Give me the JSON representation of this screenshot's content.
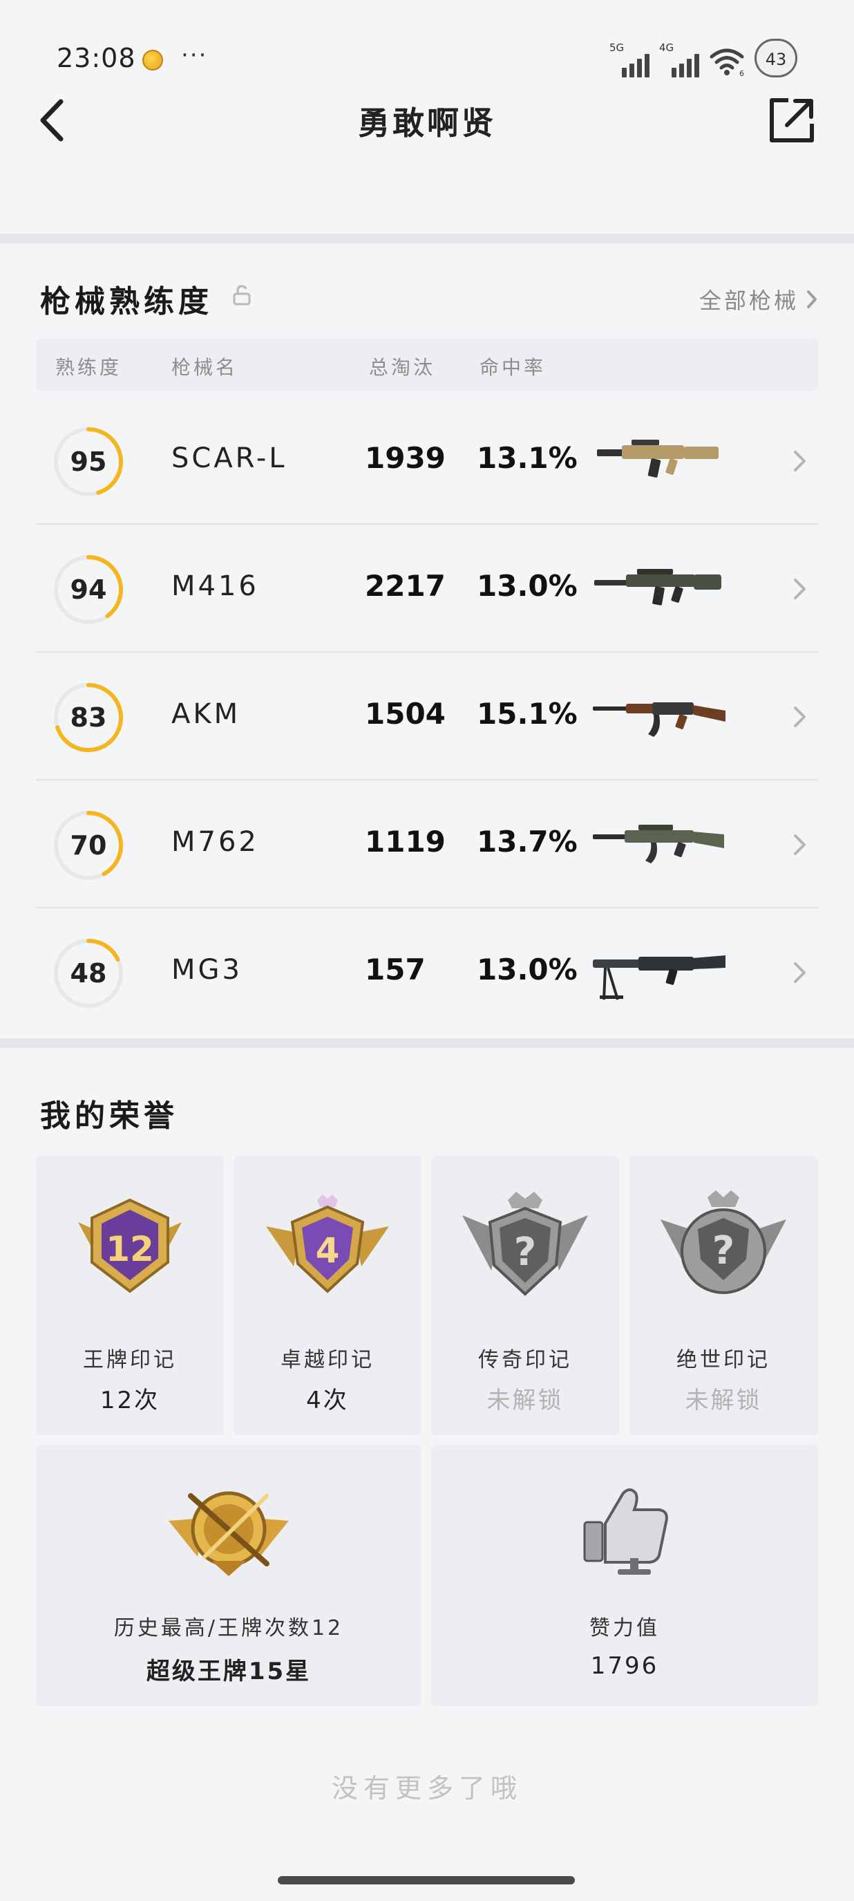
{
  "status_bar": {
    "time": "23:08",
    "more": "···",
    "signal_1_tag": "5G",
    "signal_2_tag": "4G",
    "wifi_tag": "6",
    "battery": "43"
  },
  "nav": {
    "title": "勇敢啊贤",
    "back_icon": "chevron-left-icon",
    "share_icon": "share-external-icon"
  },
  "mastery": {
    "title": "枪械熟练度",
    "lock_icon": "unlock-icon",
    "all_weapons_link": "全部枪械",
    "columns": {
      "proficiency": "熟练度",
      "weapon_name": "枪械名",
      "total_kills": "总淘汰",
      "hit_rate": "命中率"
    },
    "ring_color": "#f5b51e",
    "weapons": [
      {
        "level": "95",
        "level_fraction": 0.45,
        "name": "SCAR-L",
        "kills": "1939",
        "hit_rate": "13.1%",
        "body_color": "#b79a6a"
      },
      {
        "level": "94",
        "level_fraction": 0.4,
        "name": "M416",
        "kills": "2217",
        "hit_rate": "13.0%",
        "body_color": "#4a5044"
      },
      {
        "level": "83",
        "level_fraction": 0.7,
        "name": "AKM",
        "kills": "1504",
        "hit_rate": "15.1%",
        "body_color": "#6e3e22"
      },
      {
        "level": "70",
        "level_fraction": 0.42,
        "name": "M762",
        "kills": "1119",
        "hit_rate": "13.7%",
        "body_color": "#5a6350"
      },
      {
        "level": "48",
        "level_fraction": 0.18,
        "name": "MG3",
        "kills": "157",
        "hit_rate": "13.0%",
        "body_color": "#2f3236"
      }
    ]
  },
  "honors": {
    "title": "我的荣誉",
    "cards": [
      {
        "emblem_text": "12",
        "label": "王牌印记",
        "value": "12次",
        "locked": false
      },
      {
        "emblem_text": "4",
        "label": "卓越印记",
        "value": "4次",
        "locked": false
      },
      {
        "emblem_text": "?",
        "label": "传奇印记",
        "value": "未解锁",
        "locked": true
      },
      {
        "emblem_text": "?",
        "label": "绝世印记",
        "value": "未解锁",
        "locked": true
      }
    ],
    "highest": {
      "label": "历史最高/王牌次数12",
      "value": "超级王牌15星"
    },
    "likes": {
      "label": "赞力值",
      "value": "1796"
    }
  },
  "footer": {
    "note": "没有更多了哦"
  }
}
